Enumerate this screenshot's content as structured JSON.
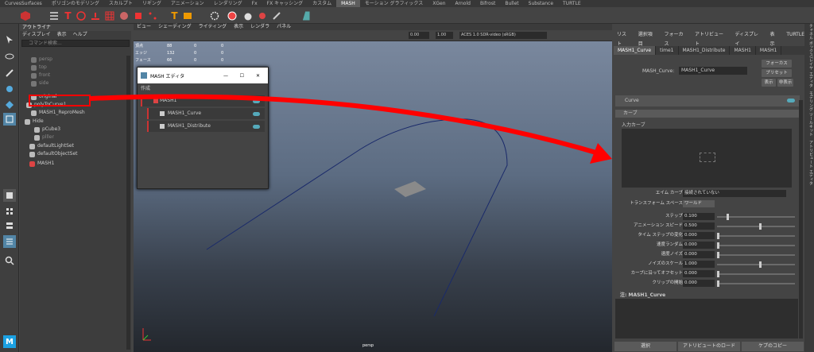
{
  "shelf_tabs": [
    "CurvesSurfaces",
    "ポリゴンのモデリング",
    "スカルプト",
    "リギング",
    "アニメーション",
    "レンダリング",
    "Fx",
    "FX キャッシング",
    "カスタム",
    "MASH",
    "モーション グラフィックス",
    "XGen",
    "Arnold",
    "Bifrost",
    "Bullet",
    "Substance",
    "TURTLE"
  ],
  "active_shelf_tab": "MASH",
  "outliner": {
    "title": "アウトライナ",
    "menu": [
      "ディスプレイ",
      "表示",
      "ヘルプ"
    ],
    "search_placeholder": "コマンド検索...",
    "items": [
      "persp",
      "top",
      "front",
      "side",
      "original",
      "polyToCurve1",
      "MASH1_ReproMesh",
      "Hide",
      "pCube3",
      "plller",
      "defaultLightSet",
      "defaultObjectSet",
      "MASH1"
    ]
  },
  "viewport": {
    "menu": [
      "ビュー",
      "シェーディング",
      "ライティング",
      "表示",
      "レンダラ",
      "パネル"
    ],
    "hud": [
      [
        "頂点",
        "88",
        "0",
        "0"
      ],
      [
        "エッジ",
        "132",
        "0",
        "0"
      ],
      [
        "フェース",
        "66",
        "0",
        "0"
      ]
    ],
    "exposure": "0.00",
    "gamma": "1.00",
    "colorspace": "ACES 1.0 SDR-video (sRGB)",
    "camera": "persp"
  },
  "mash_editor": {
    "title": "MASH エディタ",
    "menu": "作成",
    "nodes": [
      "MASH1",
      "MASH1_Curve",
      "MASH1_Distribute"
    ]
  },
  "attr_editor": {
    "menu": [
      "リスト",
      "選択項目",
      "フォーカス",
      "アトリビュート",
      "ディスプレイ",
      "表示",
      "TURTLE"
    ],
    "tabs": [
      "MASH1_Curve",
      "time1",
      "MASH1_Distribute",
      "MASH1",
      "MASH1"
    ],
    "node_label": "MASH_Curve:",
    "node_value": "MASH1_Curve",
    "focus_btn": "フォーカス",
    "preset_btn": "プリセット",
    "show_btn": "表示",
    "hide_btn": "非表示",
    "section": "Curve",
    "subsection": "カーブ",
    "input_curve": "入力カーブ",
    "aim_curve_label": "エイム カーブ",
    "aim_curve_value": "接続されていない",
    "space_label": "トランスフォーム スペース",
    "space_value": "ワールド",
    "rows": [
      {
        "label": "ステップ",
        "value": "0.100",
        "pos": 0.12
      },
      {
        "label": "アニメーション スピード",
        "value": "0.500",
        "pos": 0.55
      },
      {
        "label": "タイム ステップの変化",
        "value": "0.000",
        "pos": 0.0
      },
      {
        "label": "速度ランダム",
        "value": "0.000",
        "pos": 0.0
      },
      {
        "label": "速度ノイズ",
        "value": "0.000",
        "pos": 0.0
      },
      {
        "label": "ノイズのスケール",
        "value": "1.000",
        "pos": 0.55
      },
      {
        "label": "カーブに沿ってオフセット",
        "value": "0.000",
        "pos": 0.0
      },
      {
        "label": "クリップの開始",
        "value": "0.000",
        "pos": 0.0
      }
    ],
    "note": "注: MASH1_Curve",
    "bottom_buttons": [
      "選択",
      "アトリビュートのロード",
      "ケプのコピー"
    ]
  },
  "side_strip": "チャネル ボックス/レイヤ エディタ　モデリング ツールキット　アトリビュート エディタ",
  "colors": {
    "red": "#ff0000",
    "accent": "#5285a6"
  }
}
